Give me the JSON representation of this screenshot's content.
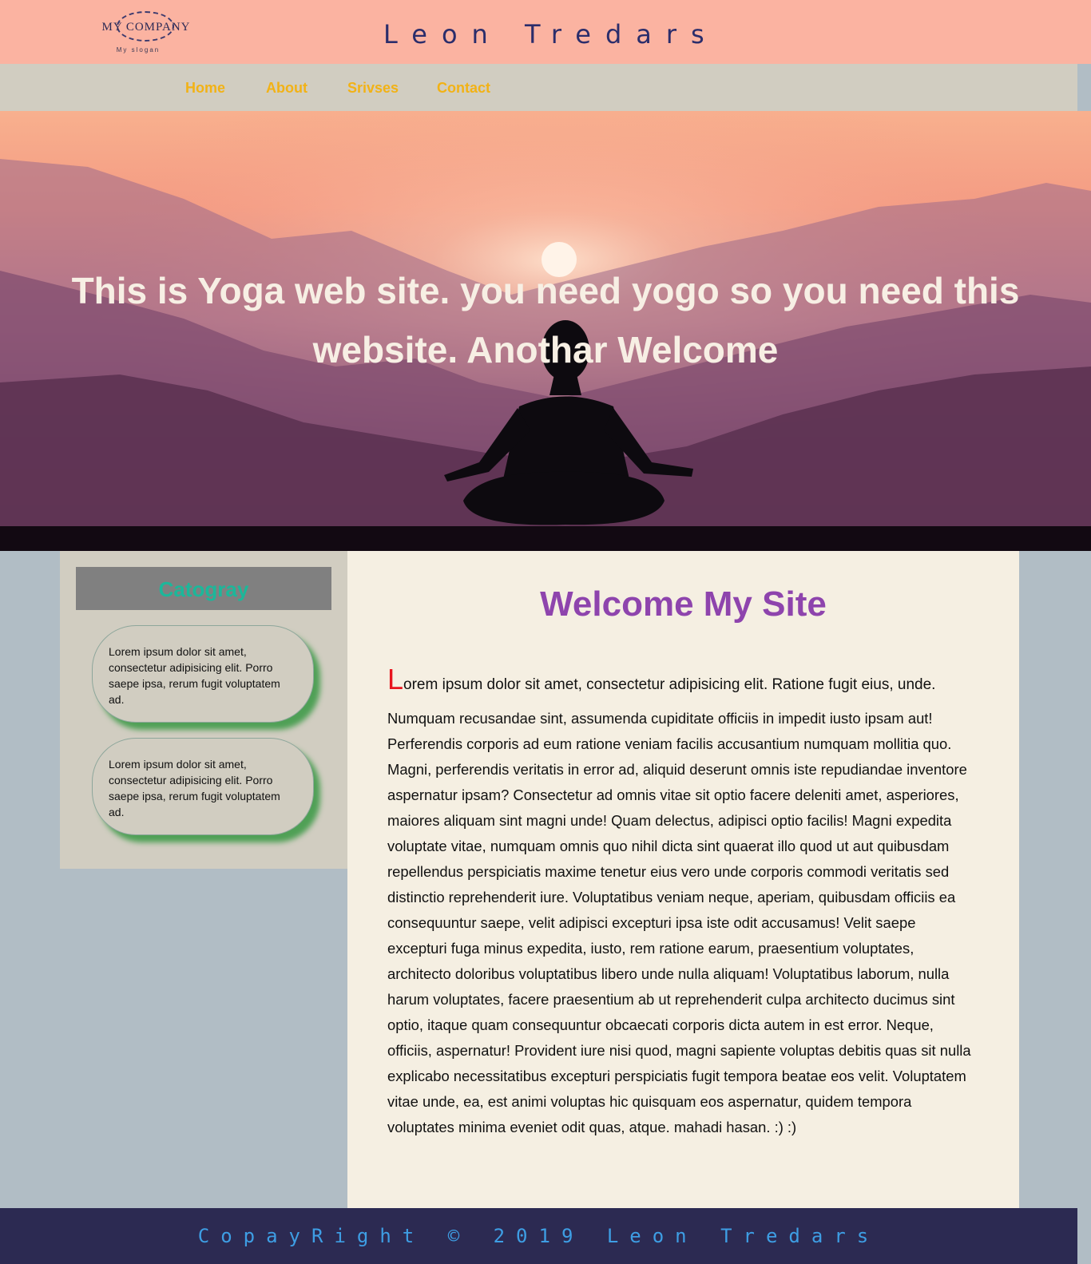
{
  "header": {
    "logo": {
      "name": "MY COMPANY",
      "slogan": "My slogan"
    },
    "title": "Leon Tredars"
  },
  "nav": {
    "items": [
      "Home",
      "About",
      "Srivses",
      "Contact"
    ]
  },
  "hero": {
    "headline": "This is Yoga web site. you need yogo so you need this website. Anothar Welcome"
  },
  "sidebar": {
    "title": "Catogray",
    "cards": [
      "Lorem ipsum dolor sit amet, consectetur adipisicing elit. Porro saepe ipsa, rerum fugit voluptatem ad.",
      "Lorem ipsum dolor sit amet, consectetur adipisicing elit. Porro saepe ipsa, rerum fugit voluptatem ad."
    ]
  },
  "main": {
    "heading": "Welcome My Site",
    "lead_cap": "L",
    "lead_rest": "orem ipsum dolor sit amet, consectetur adipisicing elit. Ratione fugit eius, unde.",
    "body": "Numquam recusandae sint, assumenda cupiditate officiis in impedit iusto ipsam aut! Perferendis corporis ad eum ratione veniam facilis accusantium numquam mollitia quo. Magni, perferendis veritatis in error ad, aliquid deserunt omnis iste repudiandae inventore aspernatur ipsam? Consectetur ad omnis vitae sit optio facere deleniti amet, asperiores, maiores aliquam sint magni unde! Quam delectus, adipisci optio facilis! Magni expedita voluptate vitae, numquam omnis quo nihil dicta sint quaerat illo quod ut aut quibusdam repellendus perspiciatis maxime tenetur eius vero unde corporis commodi veritatis sed distinctio reprehenderit iure. Voluptatibus veniam neque, aperiam, quibusdam officiis ea consequuntur saepe, velit adipisci excepturi ipsa iste odit accusamus! Velit saepe excepturi fuga minus expedita, iusto, rem ratione earum, praesentium voluptates, architecto doloribus voluptatibus libero unde nulla aliquam! Voluptatibus laborum, nulla harum voluptates, facere praesentium ab ut reprehenderit culpa architecto ducimus sint optio, itaque quam consequuntur obcaecati corporis dicta autem in est error. Neque, officiis, aspernatur! Provident iure nisi quod, magni sapiente voluptas debitis quas sit nulla explicabo necessitatibus excepturi perspiciatis fugit tempora beatae eos velit. Voluptatem vitae unde, ea, est animi voluptas hic quisquam eos aspernatur, quidem tempora voluptates minima eveniet odit quas, atque. mahadi hasan. :) :)"
  },
  "footer": {
    "text": "CopayRight © 2019 Leon Tredars"
  },
  "colors": {
    "header_bg": "#fbb3a1",
    "nav_bg": "#d1cdc1",
    "nav_link": "#f2b215",
    "title": "#2b2d6b",
    "heading": "#8e44ad",
    "category_title": "#1cb79a",
    "dropcap": "#e8141e",
    "footer_bg": "#2c2a52",
    "footer_text": "#3e9ee4"
  },
  "icons": {
    "logo": "company-logo",
    "hero_image": "meditation-silhouette-sunset"
  }
}
